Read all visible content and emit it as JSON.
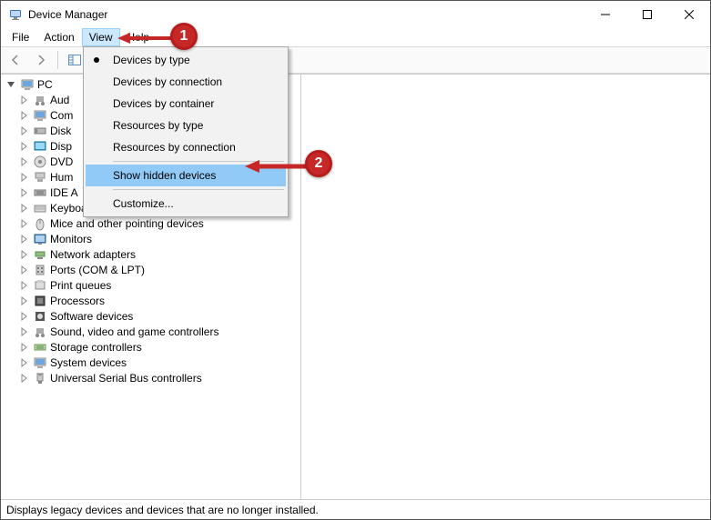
{
  "window": {
    "title": "Device Manager"
  },
  "menubar": {
    "file": "File",
    "action": "Action",
    "view": "View",
    "help": "Help"
  },
  "dropdown": {
    "devices_by_type": "Devices by type",
    "devices_by_connection": "Devices by connection",
    "devices_by_container": "Devices by container",
    "resources_by_type": "Resources by type",
    "resources_by_connection": "Resources by connection",
    "show_hidden": "Show hidden devices",
    "customize": "Customize..."
  },
  "tree": {
    "root": "PC",
    "items": [
      "Audio inputs and outputs",
      "Computer",
      "Disk drives",
      "Display adapters",
      "DVD/CD-ROM drives",
      "Human Interface Devices",
      "IDE ATA/ATAPI controllers",
      "Keyboards",
      "Mice and other pointing devices",
      "Monitors",
      "Network adapters",
      "Ports (COM & LPT)",
      "Print queues",
      "Processors",
      "Software devices",
      "Sound, video and game controllers",
      "Storage controllers",
      "System devices",
      "Universal Serial Bus controllers"
    ]
  },
  "statusbar": {
    "text": "Displays legacy devices and devices that are no longer installed."
  },
  "annotations": {
    "step1": "1",
    "step2": "2"
  }
}
